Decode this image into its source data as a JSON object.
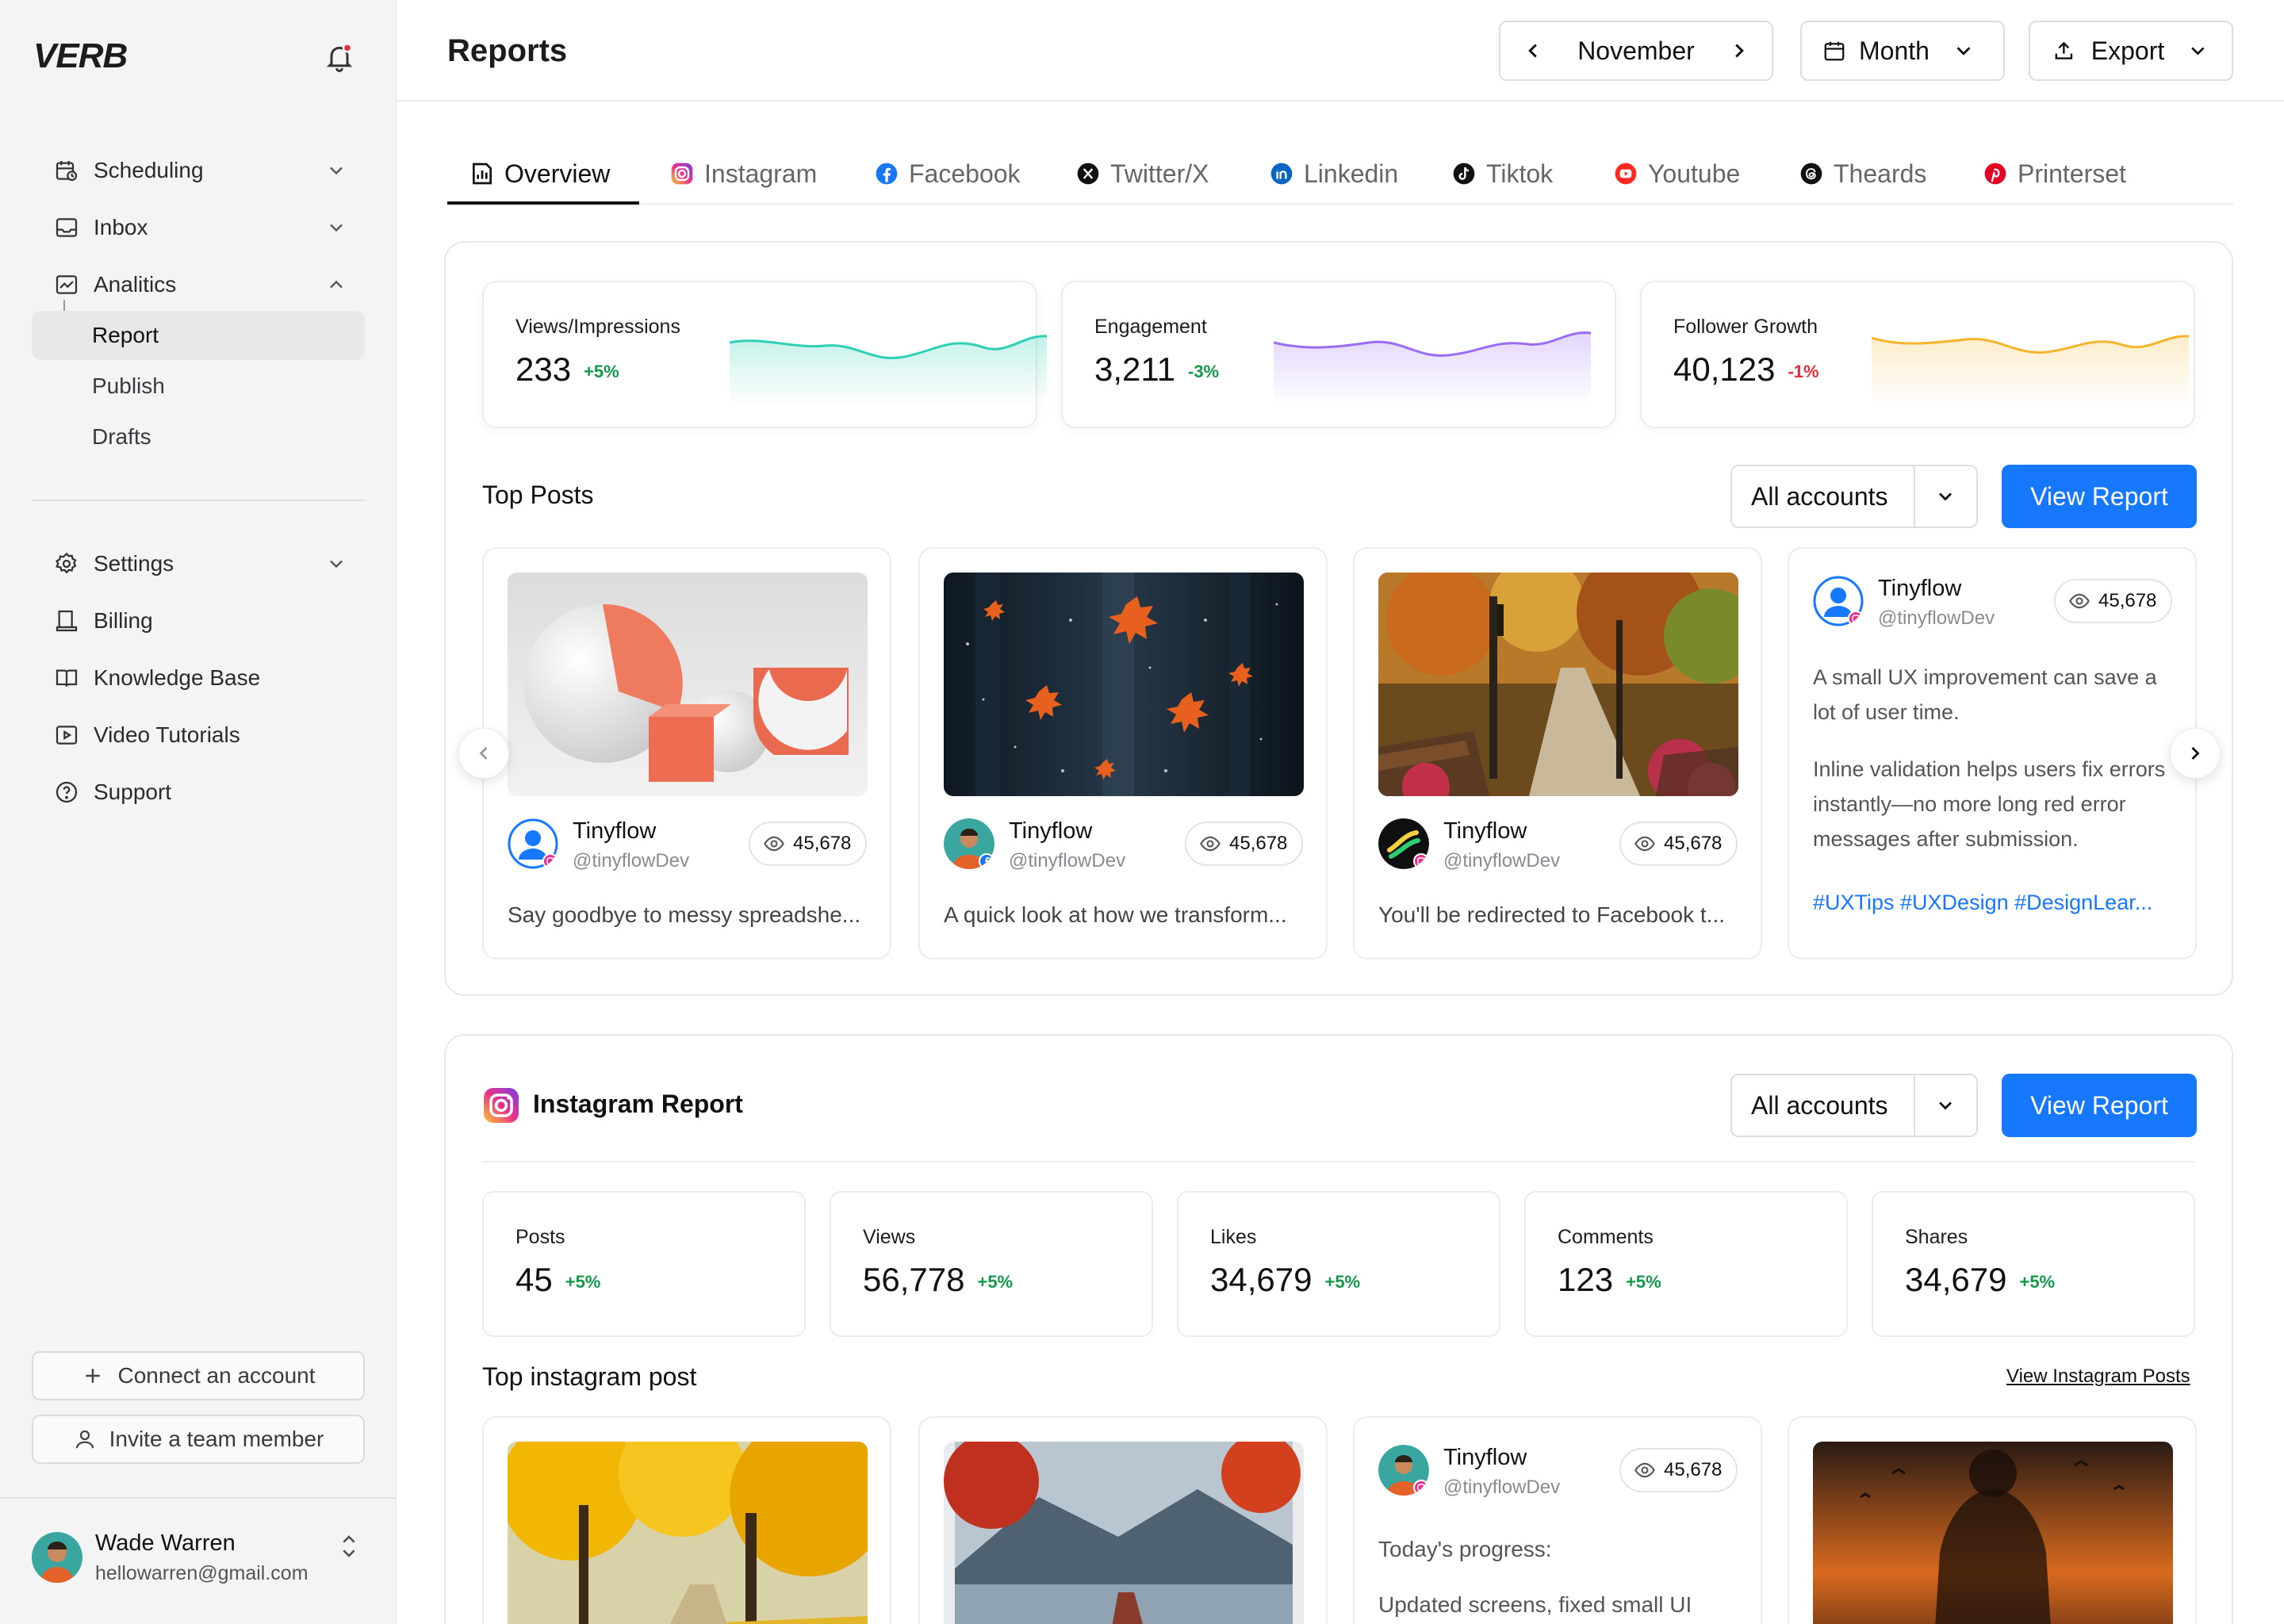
{
  "app": {
    "logo": "VERB"
  },
  "sidebar": {
    "items": [
      {
        "label": "Scheduling"
      },
      {
        "label": "Inbox"
      },
      {
        "label": "Analitics"
      },
      {
        "label": "Settings"
      },
      {
        "label": "Billing"
      },
      {
        "label": "Knowledge Base"
      },
      {
        "label": "Video Tutorials"
      },
      {
        "label": "Support"
      }
    ],
    "analytics_sub": [
      "Report",
      "Publish",
      "Drafts"
    ],
    "connect_label": "Connect an account",
    "invite_label": "Invite a team member",
    "user": {
      "name": "Wade Warren",
      "email": "hellowarren@gmail.com"
    }
  },
  "header": {
    "title": "Reports",
    "month": "November",
    "period": "Month",
    "export": "Export"
  },
  "tabs": [
    {
      "label": "Overview",
      "icon": "chart-icon"
    },
    {
      "label": "Instagram",
      "icon": "instagram-icon"
    },
    {
      "label": "Facebook",
      "icon": "facebook-icon"
    },
    {
      "label": "Twitter/X",
      "icon": "x-icon"
    },
    {
      "label": "Linkedin",
      "icon": "linkedin-icon"
    },
    {
      "label": "Tiktok",
      "icon": "tiktok-icon"
    },
    {
      "label": "Youtube",
      "icon": "youtube-icon"
    },
    {
      "label": "Theards",
      "icon": "threads-icon"
    },
    {
      "label": "Printerset",
      "icon": "pinterest-icon"
    }
  ],
  "overview": {
    "stats": [
      {
        "label": "Views/Impressions",
        "value": "233",
        "delta": "+5%",
        "color": "#2fcfb6"
      },
      {
        "label": "Engagement",
        "value": "3,211",
        "delta": "-3%",
        "color": "#9b6bf2"
      },
      {
        "label": "Follower Growth",
        "value": "40,123",
        "delta": "-1%",
        "color": "#f3b52a"
      }
    ],
    "top_posts_title": "Top Posts",
    "account_filter": "All accounts",
    "view_report": "View Report",
    "posts": [
      {
        "name": "Tinyflow",
        "handle": "@tinyflowDev",
        "views": "45,678",
        "caption": "Say goodbye to messy spreadshe..."
      },
      {
        "name": "Tinyflow",
        "handle": "@tinyflowDev",
        "views": "45,678",
        "caption": "A quick look at how we transform..."
      },
      {
        "name": "Tinyflow",
        "handle": "@tinyflowDev",
        "views": "45,678",
        "caption": "You'll be redirected to Facebook t..."
      },
      {
        "name": "Tinyflow",
        "handle": "@tinyflowDev",
        "views": "45,678",
        "text1": "A small UX improvement can save a lot of user time.",
        "text2": "Inline validation helps users fix errors instantly—no more long red error messages after submission.",
        "hashtags": "#UXTips #UXDesign #DesignLear..."
      }
    ]
  },
  "instagram": {
    "title": "Instagram Report",
    "account_filter": "All accounts",
    "view_report": "View Report",
    "stats": [
      {
        "label": "Posts",
        "value": "45",
        "delta": "+5%"
      },
      {
        "label": "Views",
        "value": "56,778",
        "delta": "+5%"
      },
      {
        "label": "Likes",
        "value": "34,679",
        "delta": "+5%"
      },
      {
        "label": "Comments",
        "value": "123",
        "delta": "+5%"
      },
      {
        "label": "Shares",
        "value": "34,679",
        "delta": "+5%"
      }
    ],
    "top_post_title": "Top instagram post",
    "view_posts_link": "View Instagram Posts",
    "text_post": {
      "name": "Tinyflow",
      "handle": "@tinyflowDev",
      "views": "45,678",
      "line1": "Today's progress:",
      "line2": "Updated screens, fixed small UI"
    }
  },
  "colors": {
    "accent": "#1677ff",
    "positive": "#129a4a",
    "negative": "#e0313a"
  }
}
